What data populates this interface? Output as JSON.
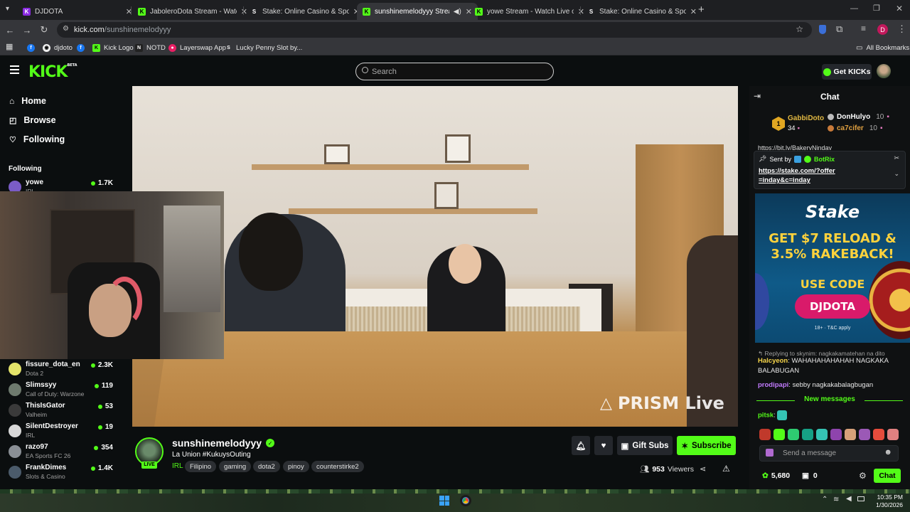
{
  "browser": {
    "tabs": [
      {
        "title": "DJDOTA",
        "favicon": "kick-purple",
        "active": false
      },
      {
        "title": "JaboleroDota Stream - Watch Li",
        "favicon": "kick",
        "active": false
      },
      {
        "title": "Stake: Online Casino & Sports B",
        "favicon": "stake",
        "active": false
      },
      {
        "title": "sunshinemelodyyy Stream",
        "favicon": "kick",
        "active": true
      },
      {
        "title": "yowe Stream - Watch Live on Ki",
        "favicon": "kick",
        "active": false
      },
      {
        "title": "Stake: Online Casino & Sports B",
        "favicon": "stake",
        "active": false
      }
    ],
    "url_domain": "kick.com",
    "url_path": "/sunshinemelodyyy",
    "bookmarks": [
      "djdoto",
      "Kick Logo",
      "NOTD",
      "Layerswap App",
      "Lucky Penny Slot by..."
    ],
    "all_bookmarks": "All Bookmarks",
    "profile_initial": "D"
  },
  "header": {
    "logo": "KICK",
    "logo_badge": "BETA",
    "search_placeholder": "Search",
    "get_kicks": "Get KICKs"
  },
  "sidebar": {
    "nav": [
      {
        "label": "Home",
        "icon": "home-icon"
      },
      {
        "label": "Browse",
        "icon": "compass-icon"
      },
      {
        "label": "Following",
        "icon": "heart-icon"
      }
    ],
    "section_title": "Following",
    "channels_top": [
      {
        "name": "yowe",
        "category": "IRL",
        "viewers": "1.7K"
      }
    ],
    "channels": [
      {
        "name": "fissure_dota_en",
        "category": "Dota 2",
        "viewers": "2.3K"
      },
      {
        "name": "Slimssyy",
        "category": "Call of Duty: Warzone",
        "viewers": "119"
      },
      {
        "name": "ThisIsGator",
        "category": "Valheim",
        "viewers": "53"
      },
      {
        "name": "SilentDestroyer",
        "category": "IRL",
        "viewers": "19"
      },
      {
        "name": "razo97",
        "category": "EA Sports FC 26",
        "viewers": "354"
      },
      {
        "name": "FrankDimes",
        "category": "Slots & Casino",
        "viewers": "1.4K"
      }
    ]
  },
  "video": {
    "watermark": "PRISM Live"
  },
  "stream": {
    "streamer": "sunshinemelodyyy",
    "live_badge": "LIVE",
    "title": "La Union #KukuysOuting",
    "category": "IRL",
    "tags": [
      "Filipino",
      "gaming",
      "dota2",
      "pinoy",
      "counterstirke2"
    ],
    "viewers": "953",
    "viewers_label": "Viewers",
    "gift_subs": "Gift Subs",
    "subscribe": "Subscribe"
  },
  "chat": {
    "title": "Chat",
    "leaderboard": [
      {
        "name": "GabbiDoto",
        "count": "34",
        "rank": "1"
      },
      {
        "name": "DonHulyo",
        "count": "10"
      },
      {
        "name": "ca7cifer",
        "count": "10"
      }
    ],
    "partial_link": "https://bit.ly/BakeryNinday",
    "pinned_sent_by": "Sent by",
    "pinned_author": "BotRix",
    "pinned_link": "https://stake.com/?offer=inday&c=inday",
    "ad": {
      "brand": "Stake",
      "headline": "GET $7 RELOAD & 3.5% RAKEBACK!",
      "use_code": "USE CODE",
      "code": "DJDOTA",
      "disclaimer": "18+ · T&C apply"
    },
    "messages": [
      {
        "reply": "Replying to skynim: nagkakamatehan na dito"
      },
      {
        "user": "Halcyeon",
        "color": "#f5d44a",
        "text": "WAHAHAHAHAHAH NAGKAKA BALABUGAN"
      },
      {
        "user": "prodipapi",
        "color": "#c27bff",
        "text": "sebby nagkakabalagbugan"
      }
    ],
    "new_messages": "New messages",
    "last_user": "pitsk",
    "input_placeholder": "Send a message",
    "points": "5,680",
    "gifts": "0",
    "send": "Chat"
  },
  "taskbar": {
    "time": "10:35 PM",
    "date": "1/30/2026"
  }
}
